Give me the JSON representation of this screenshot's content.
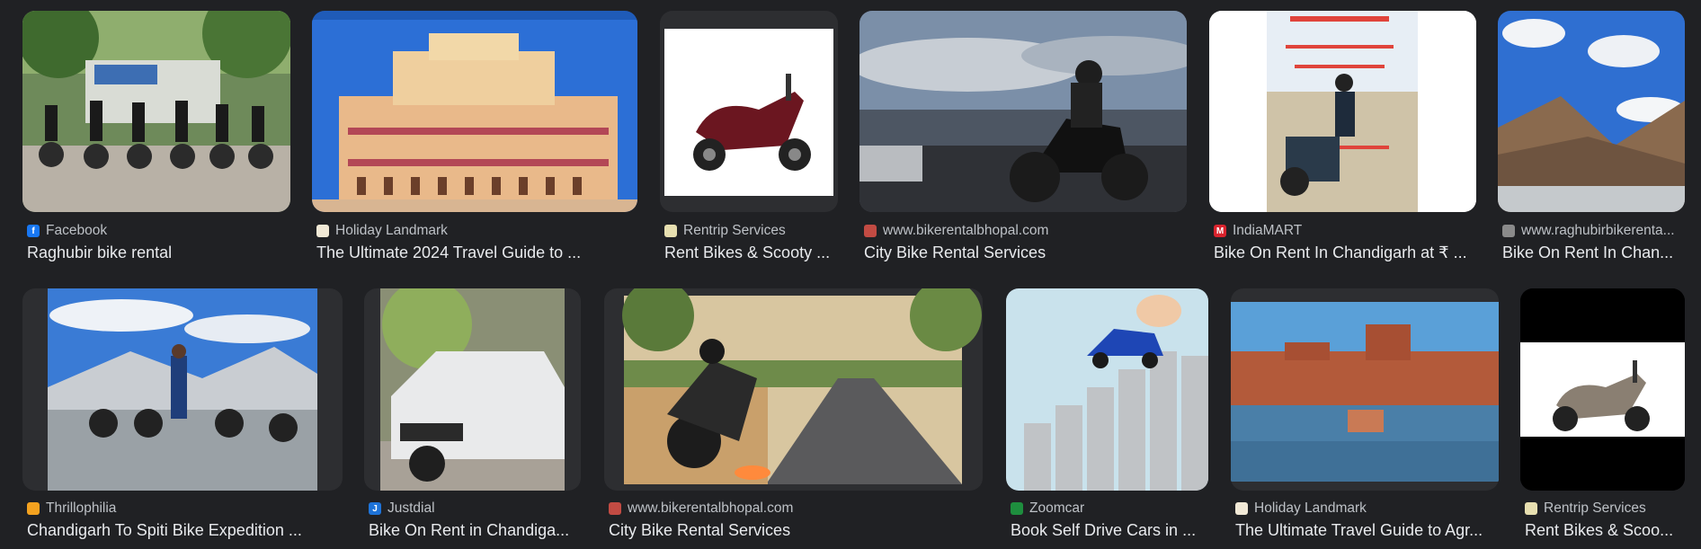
{
  "results": [
    {
      "source": "Facebook",
      "title": "Raghubir bike rental",
      "favicon": "facebook-favicon",
      "favicon_color": "#1877f2"
    },
    {
      "source": "Holiday Landmark",
      "title": "The Ultimate 2024 Travel Guide to ...",
      "favicon": "holiday-landmark-favicon",
      "favicon_color": "#f1e9d6"
    },
    {
      "source": "Rentrip Services",
      "title": "Rent Bikes & Scooty ...",
      "favicon": "rentrip-favicon",
      "favicon_color": "#e7dfb0"
    },
    {
      "source": "www.bikerentalbhopal.com",
      "title": "City Bike Rental Services",
      "favicon": "bikerentalbhopal-favicon",
      "favicon_color": "#c24b43"
    },
    {
      "source": "IndiaMART",
      "title": "Bike On Rent In Chandigarh at ₹ ...",
      "favicon": "indiamart-favicon",
      "favicon_color": "#d9232d"
    },
    {
      "source": "www.raghubirbikerenta...",
      "title": "Bike On Rent In Chan...",
      "favicon": "raghubir-favicon",
      "favicon_color": "#8a8a8a"
    },
    {
      "source": "Thrillophilia",
      "title": "Chandigarh To Spiti Bike Expedition ...",
      "favicon": "thrillophilia-favicon",
      "favicon_color": "#f4a21f"
    },
    {
      "source": "Justdial",
      "title": "Bike On Rent in Chandiga...",
      "favicon": "justdial-favicon",
      "favicon_color": "#1e73d8"
    },
    {
      "source": "www.bikerentalbhopal.com",
      "title": "City Bike Rental Services",
      "favicon": "bikerentalbhopal-favicon",
      "favicon_color": "#c24b43"
    },
    {
      "source": "Zoomcar",
      "title": "Book Self Drive Cars in ...",
      "favicon": "zoomcar-favicon",
      "favicon_color": "#1e8e3e"
    },
    {
      "source": "Holiday Landmark",
      "title": "The Ultimate Travel Guide to Agr...",
      "favicon": "holiday-landmark-favicon",
      "favicon_color": "#f1e9d6"
    },
    {
      "source": "Rentrip Services",
      "title": "Rent Bikes & Scoo...",
      "favicon": "rentrip-favicon",
      "favicon_color": "#e7dfb0"
    }
  ]
}
